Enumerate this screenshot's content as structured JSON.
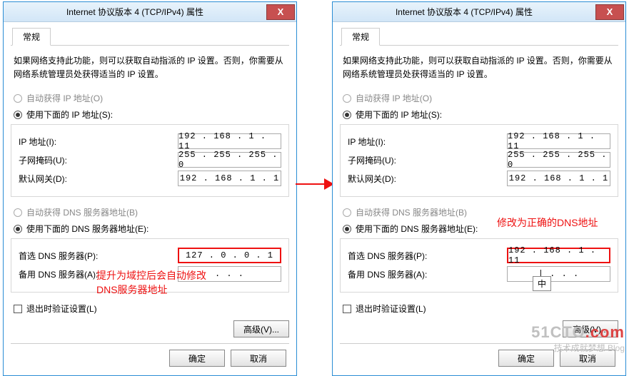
{
  "title": "Internet 协议版本 4 (TCP/IPv4) 属性",
  "close": "X",
  "tab": "常规",
  "desc": "如果网络支持此功能，则可以获取自动指派的 IP 设置。否则，你需要从网络系统管理员处获得适当的 IP 设置。",
  "ip": {
    "auto": "自动获得 IP 地址(O)",
    "manual": "使用下面的 IP 地址(S):",
    "addr_label": "IP 地址(I):",
    "mask_label": "子网掩码(U):",
    "gw_label": "默认网关(D):",
    "addr": "192 . 168 .  1  . 11",
    "mask": "255 . 255 . 255 .  0",
    "gw": "192 . 168 .  1  .  1"
  },
  "dns": {
    "auto": "自动获得 DNS 服务器地址(B)",
    "manual": "使用下面的 DNS 服务器地址(E):",
    "pref_label": "首选 DNS 服务器(P):",
    "alt_label": "备用 DNS 服务器(A):",
    "pref_left": "127 .  0  .  0  .  1",
    "alt_left": "  .     .     .  ",
    "pref_right": "192 . 168 .  1  . 11",
    "alt_right": "| .     .     .  "
  },
  "validate": "退出时验证设置(L)",
  "advanced": "高级(V)...",
  "ok": "确定",
  "cancel": "取消",
  "annot_left": "提升为域控后会自动修改\nDNS服务器地址",
  "annot_right": "修改为正确的DNS地址",
  "ime": "中",
  "watermark": {
    "main": "51CTO",
    "suffix": ".com",
    "sub": "技术成就梦想 Blog"
  }
}
